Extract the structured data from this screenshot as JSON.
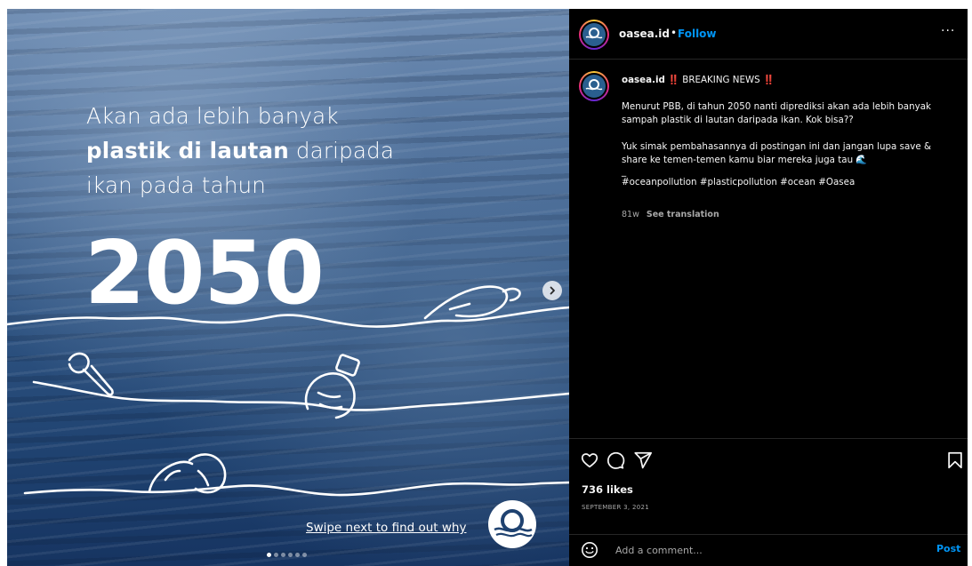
{
  "media": {
    "headline_line1": "Akan ada lebih banyak",
    "headline_line2_bold": "plastik di lautan",
    "headline_line2_rest": "daripada",
    "headline_line3": "ikan pada tahun",
    "year": "2050",
    "swipe_text": "Swipe next to find out why",
    "carousel": {
      "total": 6,
      "active_index": 0
    },
    "next_icon": "chevron-right-icon"
  },
  "post": {
    "username": "oasea.id",
    "header_separator": "•",
    "follow_label": "Follow",
    "more_label": "···",
    "caption": {
      "username": "oasea.id",
      "title": "‼️ BREAKING NEWS ‼️",
      "paragraph1": "Menurut PBB, di tahun 2050 nanti diprediksi akan ada lebih banyak sampah plastik di lautan daripada ikan. Kok bisa??",
      "paragraph2": "Yuk simak pembahasannya di postingan ini dan jangan lupa save & share ke temen-temen kamu biar mereka juga tau 🌊",
      "dash": "_",
      "hashtags": "#oceanpollution #plasticpollution #ocean #Oasea"
    },
    "age": "81w",
    "see_translation": "See translation",
    "likes": "736 likes",
    "date": "SEPTEMBER 3, 2021",
    "icons": [
      "heart-icon",
      "comment-icon",
      "share-icon",
      "bookmark-icon",
      "emoji-icon"
    ]
  },
  "comment": {
    "placeholder": "Add a comment...",
    "post_label": "Post"
  },
  "colors": {
    "accent": "#0095f6",
    "panel_bg": "#000000",
    "muted": "#a8a8a8"
  }
}
